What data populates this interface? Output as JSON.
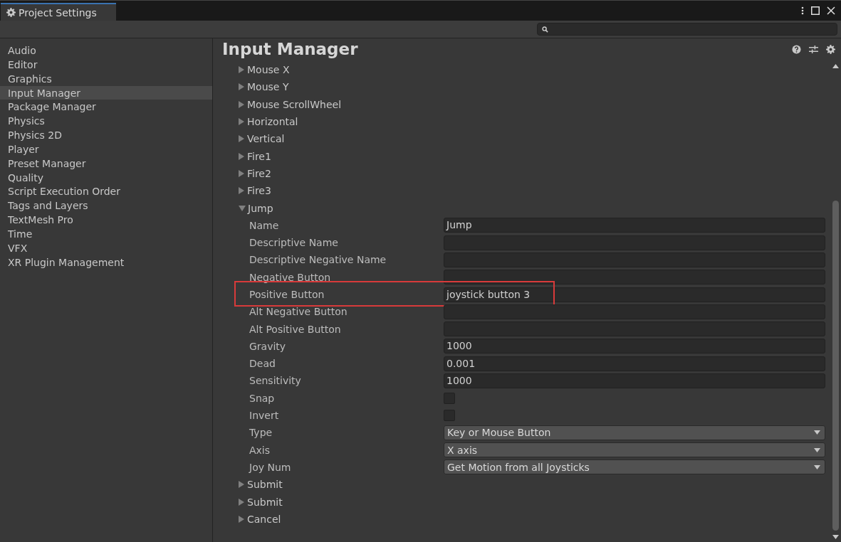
{
  "window": {
    "title": "Project Settings"
  },
  "sidebar": {
    "items": [
      {
        "label": "Audio",
        "selected": false
      },
      {
        "label": "Editor",
        "selected": false
      },
      {
        "label": "Graphics",
        "selected": false
      },
      {
        "label": "Input Manager",
        "selected": true
      },
      {
        "label": "Package Manager",
        "selected": false
      },
      {
        "label": "Physics",
        "selected": false
      },
      {
        "label": "Physics 2D",
        "selected": false
      },
      {
        "label": "Player",
        "selected": false
      },
      {
        "label": "Preset Manager",
        "selected": false
      },
      {
        "label": "Quality",
        "selected": false
      },
      {
        "label": "Script Execution Order",
        "selected": false
      },
      {
        "label": "Tags and Layers",
        "selected": false
      },
      {
        "label": "TextMesh Pro",
        "selected": false
      },
      {
        "label": "Time",
        "selected": false
      },
      {
        "label": "VFX",
        "selected": false
      },
      {
        "label": "XR Plugin Management",
        "selected": false
      }
    ]
  },
  "panel": {
    "title": "Input Manager",
    "axes": [
      {
        "name": "Mouse X",
        "expanded": false
      },
      {
        "name": "Mouse Y",
        "expanded": false
      },
      {
        "name": "Mouse ScrollWheel",
        "expanded": false
      },
      {
        "name": "Horizontal",
        "expanded": false
      },
      {
        "name": "Vertical",
        "expanded": false
      },
      {
        "name": "Fire1",
        "expanded": false
      },
      {
        "name": "Fire2",
        "expanded": false
      },
      {
        "name": "Fire3",
        "expanded": false
      },
      {
        "name": "Jump",
        "expanded": true,
        "properties": [
          {
            "label": "Name",
            "kind": "text",
            "value": "Jump",
            "highlighted": false
          },
          {
            "label": "Descriptive Name",
            "kind": "text",
            "highlighted": false
          },
          {
            "label": "Descriptive Negative Name",
            "kind": "text",
            "highlighted": false
          },
          {
            "label": "Negative Button",
            "kind": "text",
            "highlighted": false
          },
          {
            "label": "Positive Button",
            "kind": "text",
            "value": "joystick button 3",
            "highlighted": true
          },
          {
            "label": "Alt Negative Button",
            "kind": "text",
            "highlighted": false
          },
          {
            "label": "Alt Positive Button",
            "kind": "text",
            "highlighted": false
          },
          {
            "label": "Gravity",
            "kind": "text",
            "value": "1000",
            "highlighted": false
          },
          {
            "label": "Dead",
            "kind": "text",
            "value": "0.001",
            "highlighted": false
          },
          {
            "label": "Sensitivity",
            "kind": "text",
            "value": "1000",
            "highlighted": false
          },
          {
            "label": "Snap",
            "kind": "checkbox",
            "checked": false,
            "highlighted": false
          },
          {
            "label": "Invert",
            "kind": "checkbox",
            "checked": false,
            "highlighted": false
          },
          {
            "label": "Type",
            "kind": "dropdown",
            "value": "Key or Mouse Button",
            "highlighted": false
          },
          {
            "label": "Axis",
            "kind": "dropdown",
            "value": "X axis",
            "highlighted": false
          },
          {
            "label": "Joy Num",
            "kind": "dropdown",
            "value": "Get Motion from all Joysticks",
            "highlighted": false
          }
        ]
      },
      {
        "name": "Submit",
        "expanded": false
      },
      {
        "name": "Submit",
        "expanded": false
      },
      {
        "name": "Cancel",
        "expanded": false
      }
    ]
  }
}
